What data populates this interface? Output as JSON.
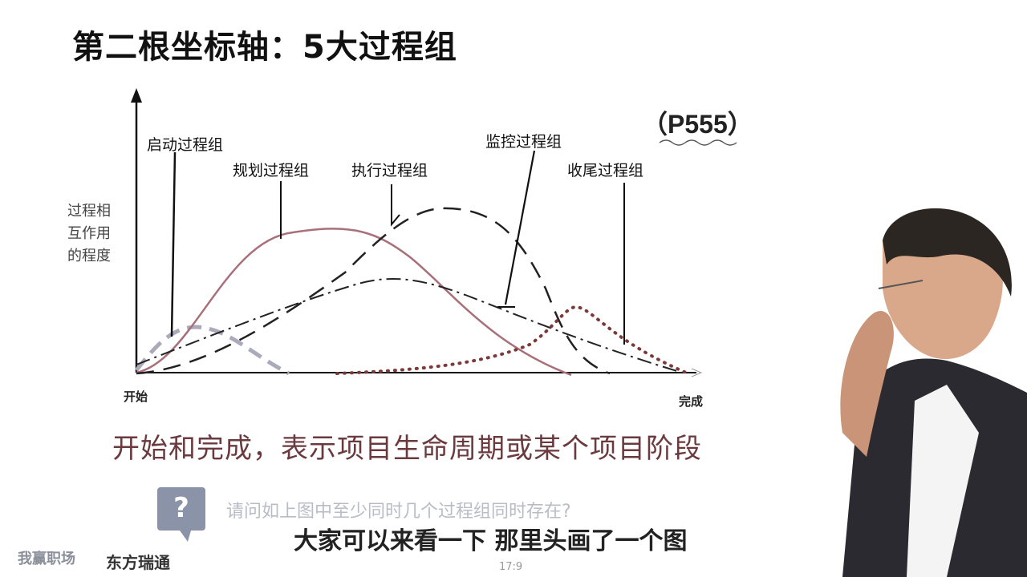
{
  "title": "第二根坐标轴：5大过程组",
  "reference": "（P555）",
  "y_axis_label": "过程相互作用的程度",
  "x_axis": {
    "start": "开始",
    "end": "完成"
  },
  "process_groups": [
    {
      "name": "启动过程组",
      "style": "dashed-gray"
    },
    {
      "name": "规划过程组",
      "style": "solid"
    },
    {
      "name": "执行过程组",
      "style": "dashed"
    },
    {
      "name": "监控过程组",
      "style": "dash-dot"
    },
    {
      "name": "收尾过程组",
      "style": "dotted"
    }
  ],
  "caption": "开始和完成，表示项目生命周期或某个项目阶段",
  "question": "请问如上图中至少同时几个过程组同时存在?",
  "subtitle": "大家可以来看一下 那里头画了一个图",
  "brand": {
    "left": "我赢职场",
    "right": "东方瑞通"
  },
  "page_number": "17:9",
  "colors": {
    "planning_curve": "#a8707a",
    "caption": "#6b3a3e",
    "question_box": "#8a93a8"
  }
}
